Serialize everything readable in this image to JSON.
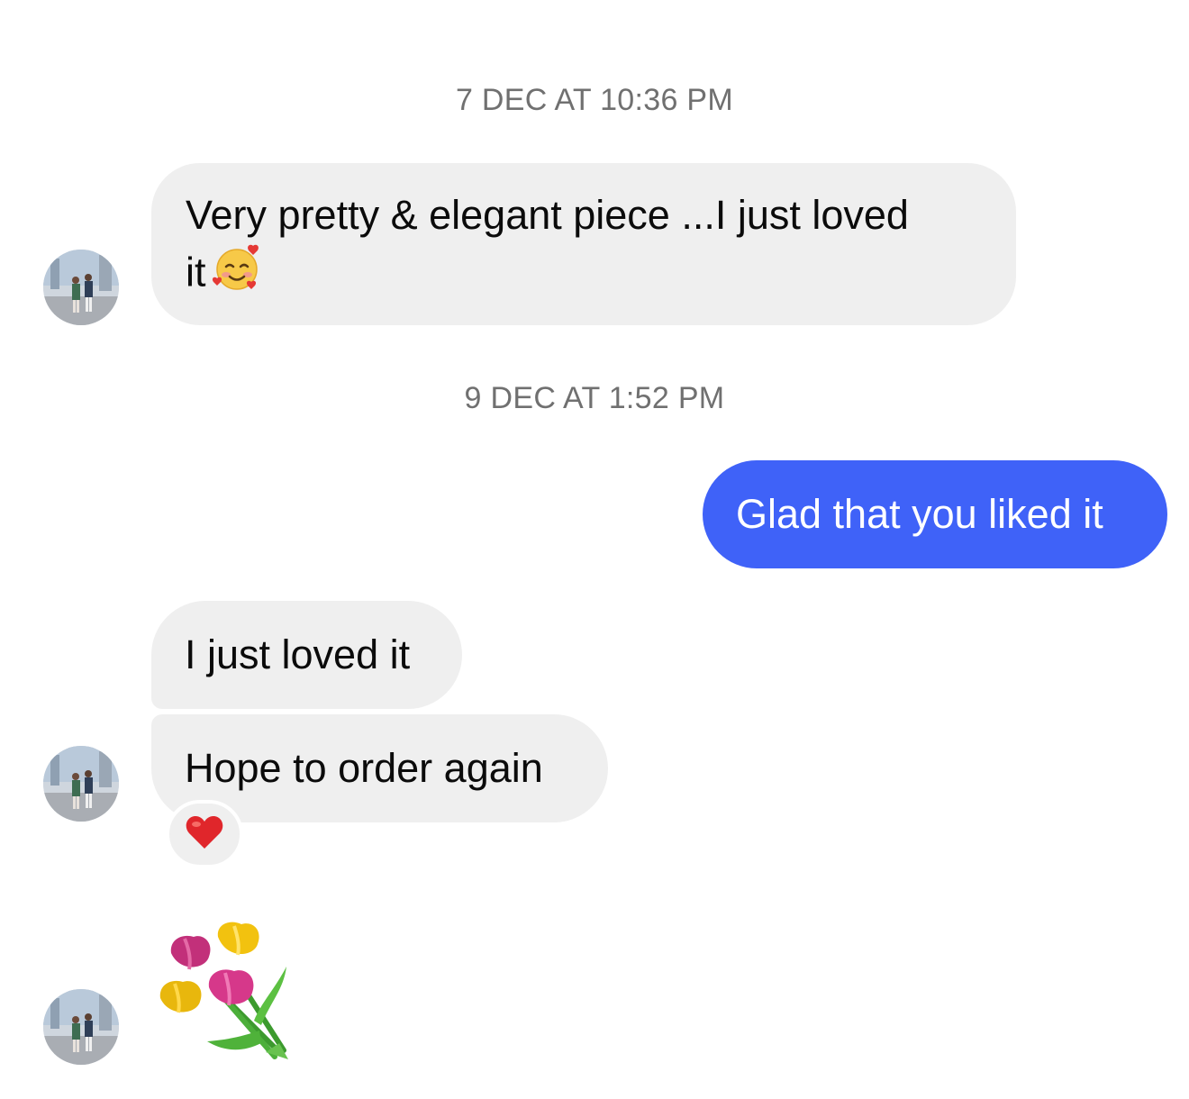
{
  "conversation": {
    "timestamps": [
      "7 DEC AT 10:36 PM",
      "9 DEC AT 1:52 PM"
    ],
    "messages": [
      {
        "id": "m1",
        "direction": "incoming",
        "text": "Very pretty & elegant piece ...I just loved",
        "text_line2": "it",
        "emoji": "smiling-face-with-hearts"
      },
      {
        "id": "m2",
        "direction": "outgoing",
        "text": "Glad that you liked it"
      },
      {
        "id": "m3",
        "direction": "incoming",
        "text": "I just loved it"
      },
      {
        "id": "m4",
        "direction": "incoming",
        "text": "Hope to order again",
        "reaction": "red-heart"
      },
      {
        "id": "m5",
        "direction": "incoming",
        "emoji": "bouquet-of-tulips"
      }
    ]
  },
  "colors": {
    "incoming_bubble": "#efefef",
    "outgoing_bubble": "#3f62f8",
    "timestamp_text": "#707070"
  }
}
